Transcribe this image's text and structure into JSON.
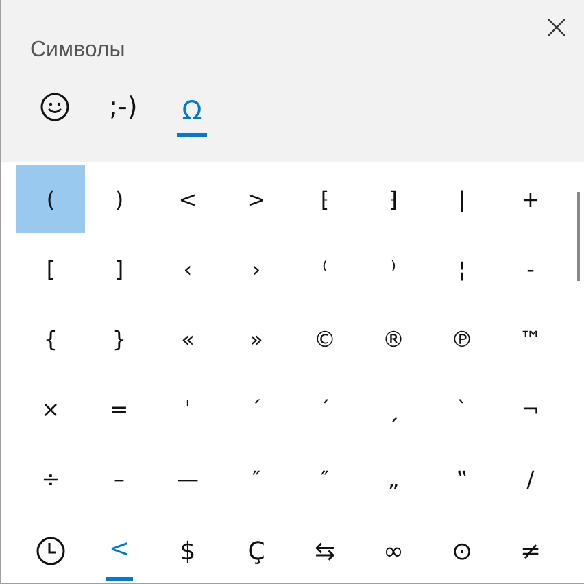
{
  "title": "Символы",
  "tabs": [
    {
      "kind": "smiley",
      "selected": false
    },
    {
      "kind": "text",
      "label": ";-)",
      "selected": false
    },
    {
      "kind": "text",
      "label": "Ω",
      "selected": true
    }
  ],
  "grid": [
    [
      {
        "symbol": "(",
        "selected": true
      },
      {
        "symbol": ")",
        "selected": false
      },
      {
        "symbol": "<",
        "selected": false
      },
      {
        "symbol": ">",
        "selected": false
      },
      {
        "symbol": "⁅",
        "selected": false
      },
      {
        "symbol": "⁆",
        "selected": false
      },
      {
        "symbol": "|",
        "selected": false
      },
      {
        "symbol": "+",
        "selected": false
      }
    ],
    [
      {
        "symbol": "[",
        "selected": false
      },
      {
        "symbol": "]",
        "selected": false
      },
      {
        "symbol": "‹",
        "selected": false
      },
      {
        "symbol": "›",
        "selected": false
      },
      {
        "symbol": "⁽",
        "selected": false
      },
      {
        "symbol": "⁾",
        "selected": false
      },
      {
        "symbol": "¦",
        "selected": false
      },
      {
        "symbol": "-",
        "selected": false
      }
    ],
    [
      {
        "symbol": "{",
        "selected": false
      },
      {
        "symbol": "}",
        "selected": false
      },
      {
        "symbol": "«",
        "selected": false
      },
      {
        "symbol": "»",
        "selected": false
      },
      {
        "symbol": "©",
        "selected": false
      },
      {
        "symbol": "®",
        "selected": false
      },
      {
        "symbol": "℗",
        "selected": false
      },
      {
        "symbol": "™",
        "selected": false
      }
    ],
    [
      {
        "symbol": "×",
        "selected": false
      },
      {
        "symbol": "=",
        "selected": false
      },
      {
        "symbol": "ˈ",
        "selected": false
      },
      {
        "symbol": "ˊ",
        "selected": false
      },
      {
        "symbol": "ˊ",
        "selected": false
      },
      {
        "symbol": "ˏ",
        "selected": false
      },
      {
        "symbol": "ˋ",
        "selected": false
      },
      {
        "symbol": "¬",
        "selected": false
      }
    ],
    [
      {
        "symbol": "÷",
        "selected": false
      },
      {
        "symbol": "–",
        "selected": false
      },
      {
        "symbol": "—",
        "selected": false
      },
      {
        "symbol": "″",
        "selected": false
      },
      {
        "symbol": "″",
        "selected": false
      },
      {
        "symbol": "„",
        "selected": false
      },
      {
        "symbol": "‟",
        "selected": false
      },
      {
        "symbol": "/",
        "selected": false
      }
    ]
  ],
  "categories": [
    {
      "kind": "recent",
      "selected": false
    },
    {
      "kind": "text",
      "label": "<",
      "selected": true
    },
    {
      "kind": "text",
      "label": "$",
      "selected": false
    },
    {
      "kind": "text",
      "label": "Ç",
      "selected": false
    },
    {
      "kind": "text",
      "label": "⇆",
      "selected": false
    },
    {
      "kind": "text",
      "label": "∞",
      "selected": false
    },
    {
      "kind": "text",
      "label": "⊙",
      "selected": false
    },
    {
      "kind": "text",
      "label": "≠",
      "selected": false
    }
  ]
}
